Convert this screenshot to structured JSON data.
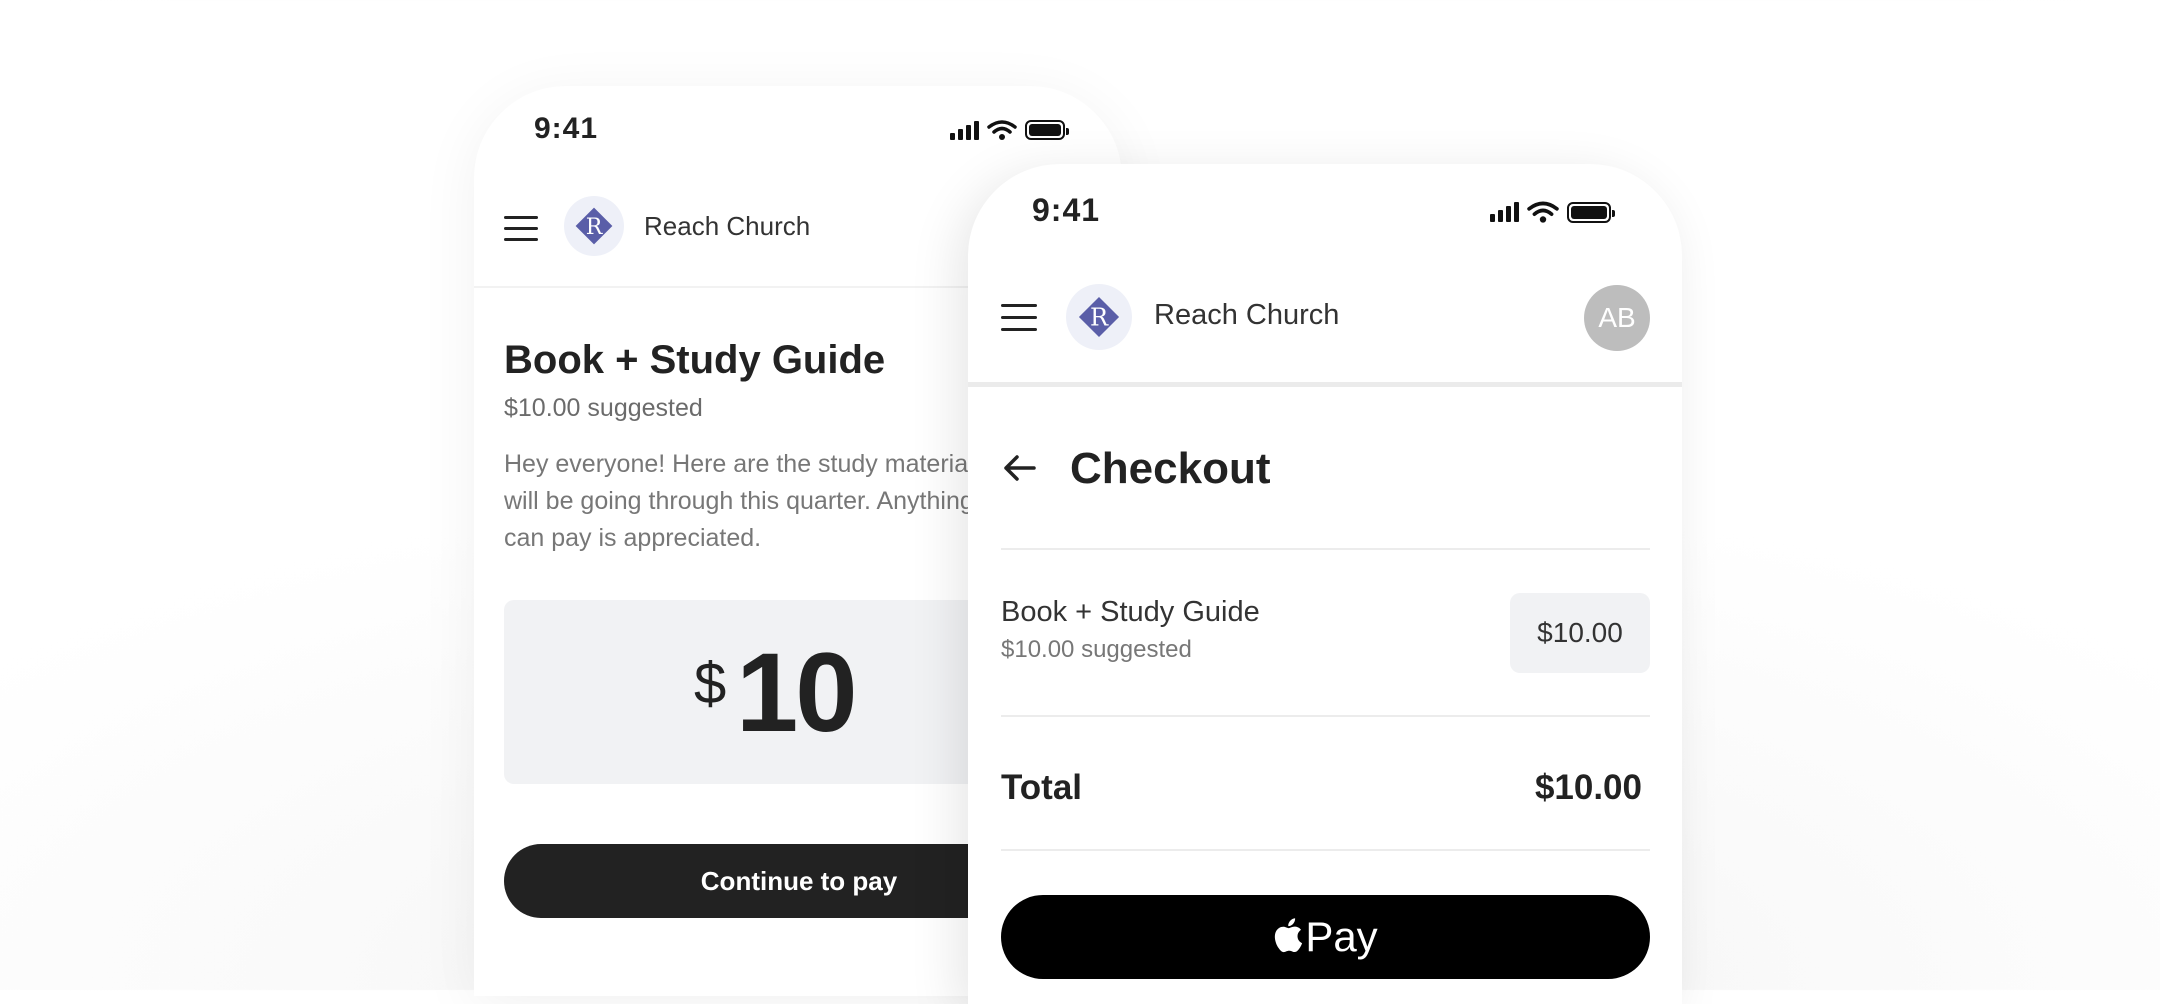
{
  "back_screen": {
    "status_time": "9:41",
    "org_name": "Reach Church",
    "logo_letter": "R",
    "fund_title": "Book + Study Guide",
    "suggested": "$10.00 suggested",
    "description": "Hey everyone! Here are the study materials we will be going through this quarter. Anything you can pay is appreciated.",
    "amount_currency": "$",
    "amount_value": "10",
    "continue_label": "Continue to pay"
  },
  "front_screen": {
    "status_time": "9:41",
    "org_name": "Reach Church",
    "logo_letter": "R",
    "avatar_initials": "AB",
    "page_title": "Checkout",
    "line_item": {
      "name": "Book + Study Guide",
      "suggested": "$10.00 suggested",
      "amount": "$10.00"
    },
    "total_label": "Total",
    "total_value": "$10.00",
    "pay_label": "Pay"
  },
  "colors": {
    "brand_logo": "#5a5ea8",
    "logo_bg": "#eef0f8",
    "dark_button": "#222222",
    "apple_pay_button": "#000000",
    "avatar_bg": "#bdbdbd"
  },
  "icons": [
    "menu-icon",
    "church-logo",
    "signal-icon",
    "wifi-icon",
    "battery-icon",
    "back-arrow-icon",
    "apple-logo-icon"
  ]
}
